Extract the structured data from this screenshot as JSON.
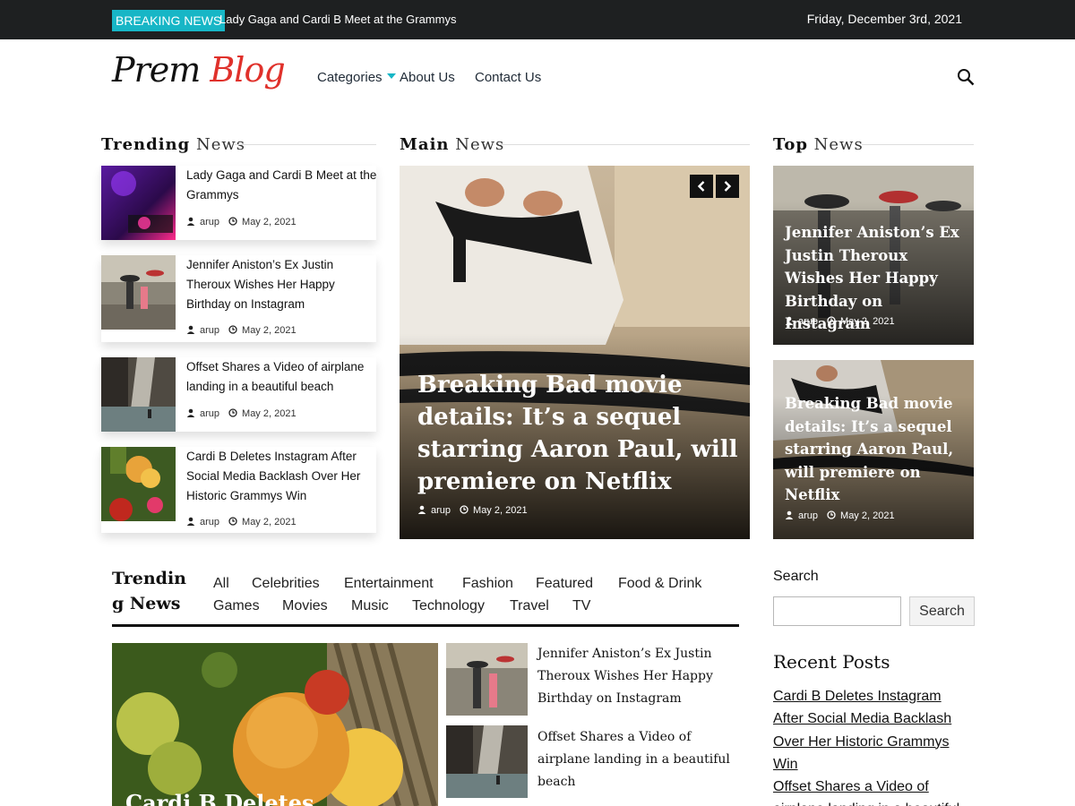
{
  "topbar": {
    "badge": "BREAKING NEWS",
    "headline": "Lady Gaga and Cardi B Meet at the Grammys",
    "date": "Friday, December 3rd, 2021"
  },
  "header": {
    "logo_part1": "Prem",
    "logo_part2": "Blog",
    "nav": [
      "Categories",
      "About Us",
      "Contact Us"
    ]
  },
  "sections": {
    "trending": {
      "bold": "Trending",
      "light": "News"
    },
    "main": {
      "bold": "Main",
      "light": "News"
    },
    "top": {
      "bold": "Top",
      "light": "News"
    }
  },
  "trending_news": [
    {
      "title": "Lady Gaga and Cardi B Meet at the Grammys",
      "author": "arup",
      "date": "May 2, 2021"
    },
    {
      "title": "Jennifer Aniston’s Ex Justin Theroux Wishes Her Happy Birthday on Instagram",
      "author": "arup",
      "date": "May 2, 2021"
    },
    {
      "title": "Offset Shares a Video of airplane landing in a beautiful beach",
      "author": "arup",
      "date": "May 2, 2021"
    },
    {
      "title": "Cardi B Deletes Instagram After Social Media Backlash Over Her Historic Grammys Win",
      "author": "arup",
      "date": "May 2, 2021"
    }
  ],
  "main_news": {
    "title": "Breaking Bad movie details: It’s a sequel starring Aaron Paul, will premiere on Netflix",
    "author": "arup",
    "date": "May 2, 2021"
  },
  "top_news": [
    {
      "title": "Jennifer Aniston’s Ex Justin Theroux Wishes Her Happy Birthday on Instagram",
      "author": "arup",
      "date": "May 2, 2021"
    },
    {
      "title": "Breaking Bad movie details: It’s a sequel starring Aaron Paul, will premiere on Netflix",
      "author": "arup",
      "date": "May 2, 2021"
    }
  ],
  "trending_block": {
    "heading": "Trending News",
    "tabs": [
      "All",
      "Celebrities",
      "Entertainment",
      "Fashion",
      "Featured",
      "Food & Drink",
      "Games",
      "Movies",
      "Music",
      "Technology",
      "Travel",
      "TV"
    ],
    "big_caption": "Cardi B Deletes",
    "side_items": [
      "Jennifer Aniston’s Ex Justin Theroux Wishes Her Happy Birthday on Instagram",
      "Offset Shares a Video of airplane landing in a beautiful beach"
    ]
  },
  "sidebar": {
    "search_label": "Search",
    "search_value": "",
    "search_button": "Search",
    "recent_heading": "Recent Posts",
    "recent_posts": [
      "Cardi B Deletes Instagram After Social Media Backlash Over Her Historic Grammys Win",
      "Offset Shares a Video of airplane landing in a beautiful beach"
    ]
  },
  "colors": {
    "accent": "#17b6c6",
    "topbar": "#1e2021",
    "logo_red": "#e0312b"
  }
}
